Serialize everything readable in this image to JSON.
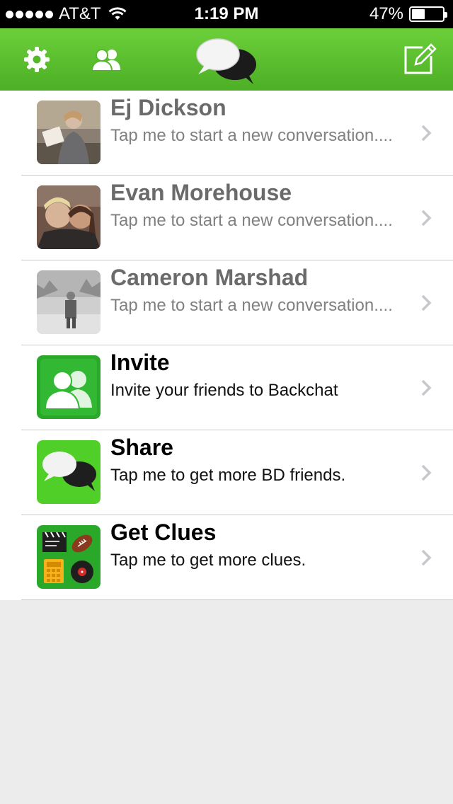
{
  "status_bar": {
    "carrier": "AT&T",
    "time": "1:19 PM",
    "battery": "47%",
    "battery_level": 0.47,
    "signal_icon": "signal-dots-icon",
    "wifi_icon": "wifi-icon"
  },
  "nav": {
    "settings_icon": "gear-icon",
    "friends_icon": "friends-icon",
    "logo_icon": "chat-bubbles-logo",
    "compose_icon": "compose-icon"
  },
  "colors": {
    "nav_green": "#5cbf2e",
    "tile_green": "#2aa82a",
    "chevron": "#c7c7cc"
  },
  "rows": [
    {
      "name": "Ej Dickson",
      "subtitle": "Tap me to start a new conversation....",
      "muted": true
    },
    {
      "name": "Evan Morehouse",
      "subtitle": "Tap me to start a new conversation....",
      "muted": true
    },
    {
      "name": "Cameron Marshad",
      "subtitle": "Tap me to start a new conversation....",
      "muted": true
    },
    {
      "name": "Invite",
      "subtitle": "Invite your friends to Backchat",
      "icon": "invite-friends-icon"
    },
    {
      "name": "Share",
      "subtitle": "Tap me to get more BD friends.",
      "icon": "share-chat-icon"
    },
    {
      "name": "Get Clues",
      "subtitle": "Tap me to get more clues.",
      "icon": "clues-icon"
    }
  ]
}
